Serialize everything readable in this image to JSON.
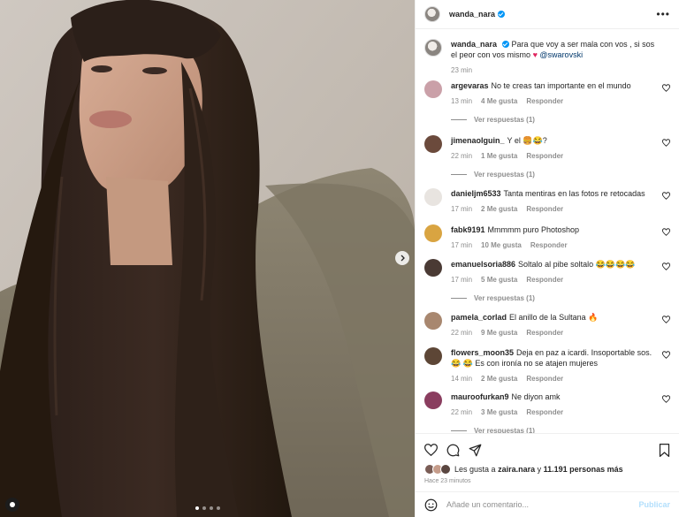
{
  "post": {
    "username": "wanda_nara",
    "verified": true,
    "caption_text": "Para que voy a ser mala con vos , si sos el peor con vos mismo",
    "caption_mention": "@swarovski",
    "caption_time": "23 min",
    "photo_indicator": {
      "count": 4,
      "active": 1
    }
  },
  "icons": {
    "like": "heart-icon",
    "comment": "comment-icon",
    "share": "send-icon",
    "save": "bookmark-icon",
    "emoji": "emoji-icon",
    "more": "more-horizontal-icon",
    "next": "chevron-right-icon",
    "user_tag": "user-tag-icon"
  },
  "comments": [
    {
      "user": "argevaras",
      "text": "No te creas tan importante en el mundo",
      "time": "13 min",
      "likes": "4 Me gusta",
      "reply": "Responder",
      "replies": "Ver respuestas (1)"
    },
    {
      "user": "jimenaolguin_",
      "text": "Y el 🍔😂?",
      "time": "22 min",
      "likes": "1 Me gusta",
      "reply": "Responder",
      "replies": "Ver respuestas (1)"
    },
    {
      "user": "danieljm6533",
      "text": "Tanta mentiras en las fotos re retocadas",
      "time": "17 min",
      "likes": "2 Me gusta",
      "reply": "Responder",
      "replies": ""
    },
    {
      "user": "fabk9191",
      "text": "Mmmmm puro Photoshop",
      "time": "17 min",
      "likes": "10 Me gusta",
      "reply": "Responder",
      "replies": ""
    },
    {
      "user": "emanuelsoria886",
      "text": "Soltalo al pibe soltalo 😂😂😂😂",
      "time": "17 min",
      "likes": "5 Me gusta",
      "reply": "Responder",
      "replies": "Ver respuestas (1)"
    },
    {
      "user": "pamela_corlad",
      "text": "El anillo de la Sultana 🔥",
      "time": "22 min",
      "likes": "9 Me gusta",
      "reply": "Responder",
      "replies": ""
    },
    {
      "user": "flowers_moon35",
      "text": "Deja en paz a icardi. Insoportable sos. 😂 😂 Es con ironía no se atajen mujeres",
      "time": "14 min",
      "likes": "2 Me gusta",
      "reply": "Responder",
      "replies": ""
    },
    {
      "user": "mauroofurkan9",
      "text": "Ne diyon amk",
      "time": "22 min",
      "likes": "3 Me gusta",
      "reply": "Responder",
      "replies": "Ver respuestas (1)"
    }
  ],
  "likes_summary": {
    "prefix": "Les gusta a",
    "first_user": "zaira.nara",
    "connector": "y",
    "others": "11.191 personas más"
  },
  "posted_ago": "Hace 23 minutos",
  "comment_box": {
    "placeholder": "Añade un comentario...",
    "publish_label": "Publicar"
  },
  "colors": {
    "verified": "#0095f6",
    "heart": "#e0245e",
    "publish_disabled": "#b2dffc"
  }
}
